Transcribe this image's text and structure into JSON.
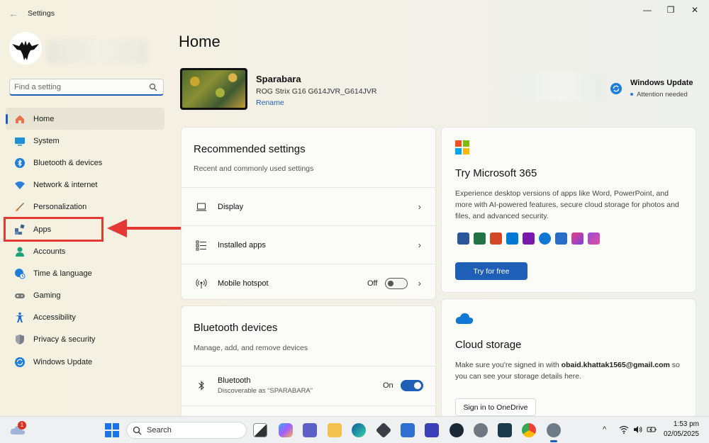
{
  "window": {
    "title": "Settings",
    "back": "←",
    "minimize": "—",
    "restore": "❐",
    "close": "✕"
  },
  "sidebar": {
    "search_placeholder": "Find a setting",
    "items": [
      {
        "label": "Home",
        "icon": "home-icon",
        "color": "#e8734a"
      },
      {
        "label": "System",
        "icon": "monitor-icon",
        "color": "#1f8fd8"
      },
      {
        "label": "Bluetooth & devices",
        "icon": "bluetooth-icon",
        "color": "#1f7fd8"
      },
      {
        "label": "Network & internet",
        "icon": "wifi-icon",
        "color": "#2b7fd8"
      },
      {
        "label": "Personalization",
        "icon": "brush-icon",
        "color": "#d9772c"
      },
      {
        "label": "Apps",
        "icon": "apps-icon",
        "color": "#4a6f9c"
      },
      {
        "label": "Accounts",
        "icon": "person-icon",
        "color": "#1aa37a"
      },
      {
        "label": "Time & language",
        "icon": "clock-globe-icon",
        "color": "#1f7fd8"
      },
      {
        "label": "Gaming",
        "icon": "gamepad-icon",
        "color": "#7a7a7a"
      },
      {
        "label": "Accessibility",
        "icon": "accessibility-icon",
        "color": "#1f6fd0"
      },
      {
        "label": "Privacy & security",
        "icon": "shield-icon",
        "color": "#7b8088"
      },
      {
        "label": "Windows Update",
        "icon": "update-icon",
        "color": "#1f7fd8"
      }
    ]
  },
  "main": {
    "title": "Home",
    "device": {
      "name": "Sparabara",
      "model": "ROG Strix G16 G614JVR_G614JVR",
      "rename": "Rename"
    },
    "windows_update": {
      "title": "Windows Update",
      "status": "Attention needed"
    },
    "recommended": {
      "title": "Recommended settings",
      "subtitle": "Recent and commonly used settings",
      "rows": [
        {
          "label": "Display",
          "chevron": "›"
        },
        {
          "label": "Installed apps",
          "chevron": "›"
        },
        {
          "label": "Mobile hotspot",
          "state": "Off",
          "chevron": "›"
        }
      ]
    },
    "bluetooth": {
      "title": "Bluetooth devices",
      "subtitle": "Manage, add, and remove devices",
      "device_label": "Bluetooth",
      "device_sub": "Discoverable as “SPARABARA”",
      "state": "On"
    },
    "m365": {
      "title": "Try Microsoft 365",
      "description": "Experience desktop versions of apps like Word, PowerPoint, and more with AI-powered features, secure cloud storage for photos and files, and advanced security.",
      "button": "Try for free"
    },
    "cloud": {
      "title": "Cloud storage",
      "desc_prefix": "Make sure you're signed in with ",
      "email": "obaid.khattak1565@gmail.com",
      "desc_suffix": " so you can see your storage details here.",
      "button": "Sign in to OneDrive"
    }
  },
  "taskbar": {
    "notification_count": "1",
    "search_label": "Search",
    "time": "1:53 pm",
    "date": "02/05/2025",
    "tray_chevron": "^"
  },
  "colors": {
    "accent": "#1f5fb8",
    "annotation": "#e53935"
  }
}
